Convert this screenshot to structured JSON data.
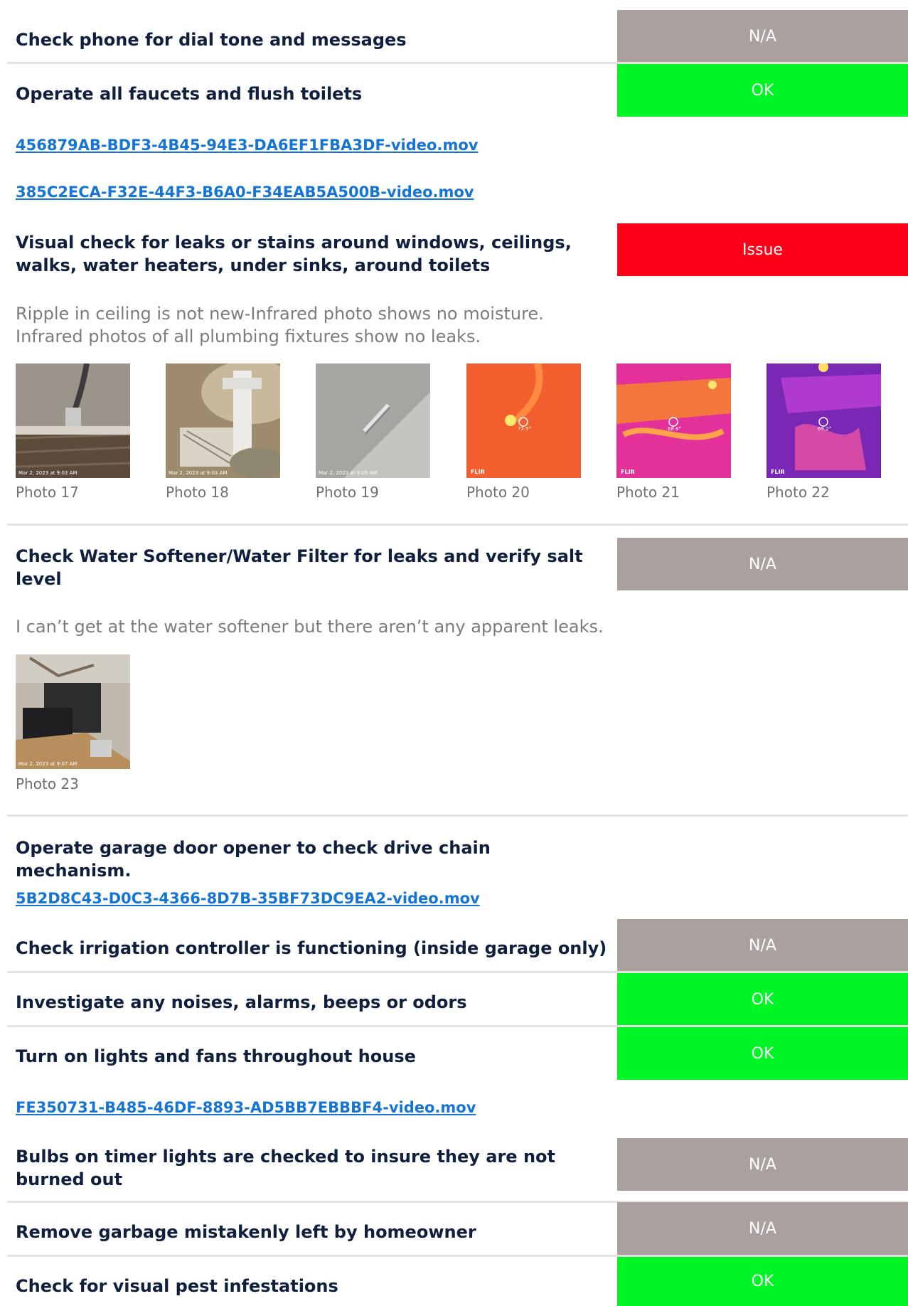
{
  "items": {
    "phone": {
      "title": "Check phone for dial tone and messages",
      "status": "N/A"
    },
    "faucets": {
      "title": "Operate all faucets and flush toilets",
      "status": "OK"
    },
    "faucets_videos": [
      "456879AB-BDF3-4B45-94E3-DA6EF1FBA3DF-video.mov",
      "385C2ECA-F32E-44F3-B6A0-F34EAB5A500B-video.mov"
    ],
    "leaks": {
      "title": "Visual check for leaks or stains around windows, ceilings, walks, water heaters, under sinks, around toilets",
      "status": "Issue",
      "note_line1": "Ripple in ceiling is not new-Infrared photo shows no moisture.",
      "note_line2": "Infrared photos of all plumbing fixtures show no leaks.",
      "photos": [
        "Photo 17",
        "Photo 18",
        "Photo 19",
        "Photo 20",
        "Photo 21",
        "Photo 22"
      ],
      "stamps": [
        "Mar 2, 2023 at 9:03 AM",
        "Mar 2, 2023 at 9:03 AM",
        "Mar 2, 2023 at 9:05 AM"
      ],
      "flir_readings": [
        "72.5°",
        "68.8°",
        "69.2°"
      ],
      "flir_brand": "FLIR"
    },
    "softener": {
      "title": "Check Water Softener/Water Filter for leaks and verify salt level",
      "status": "N/A",
      "note": "I can’t get at the water softener but there aren’t any apparent leaks.",
      "photo": "Photo 23",
      "stamp": "Mar 2, 2023 at 9:07 AM"
    },
    "garage": {
      "title": "Operate garage door opener to check drive chain mechanism.",
      "video": "5B2D8C43-D0C3-4366-8D7B-35BF73DC9EA2-video.mov"
    },
    "irrigation": {
      "title": "Check irrigation controller is functioning (inside garage only)",
      "status": "N/A"
    },
    "noises": {
      "title": "Investigate any noises, alarms, beeps or odors",
      "status": "OK"
    },
    "lights": {
      "title": "Turn on lights and fans throughout house",
      "status": "OK",
      "video": "FE350731-B485-46DF-8893-AD5BB7EBBBF4-video.mov"
    },
    "bulbs": {
      "title": "Bulbs on timer lights are checked to insure they are not burned out",
      "status": "N/A"
    },
    "garbage": {
      "title": "Remove garbage mistakenly left by homeowner",
      "status": "N/A"
    },
    "pests": {
      "title": "Check for visual pest infestations",
      "status": "OK"
    }
  },
  "colors": {
    "na": "#aaa19f",
    "ok": "#00f524",
    "issue": "#ff0018",
    "link": "#1574d4",
    "title": "#0f1f3d"
  }
}
